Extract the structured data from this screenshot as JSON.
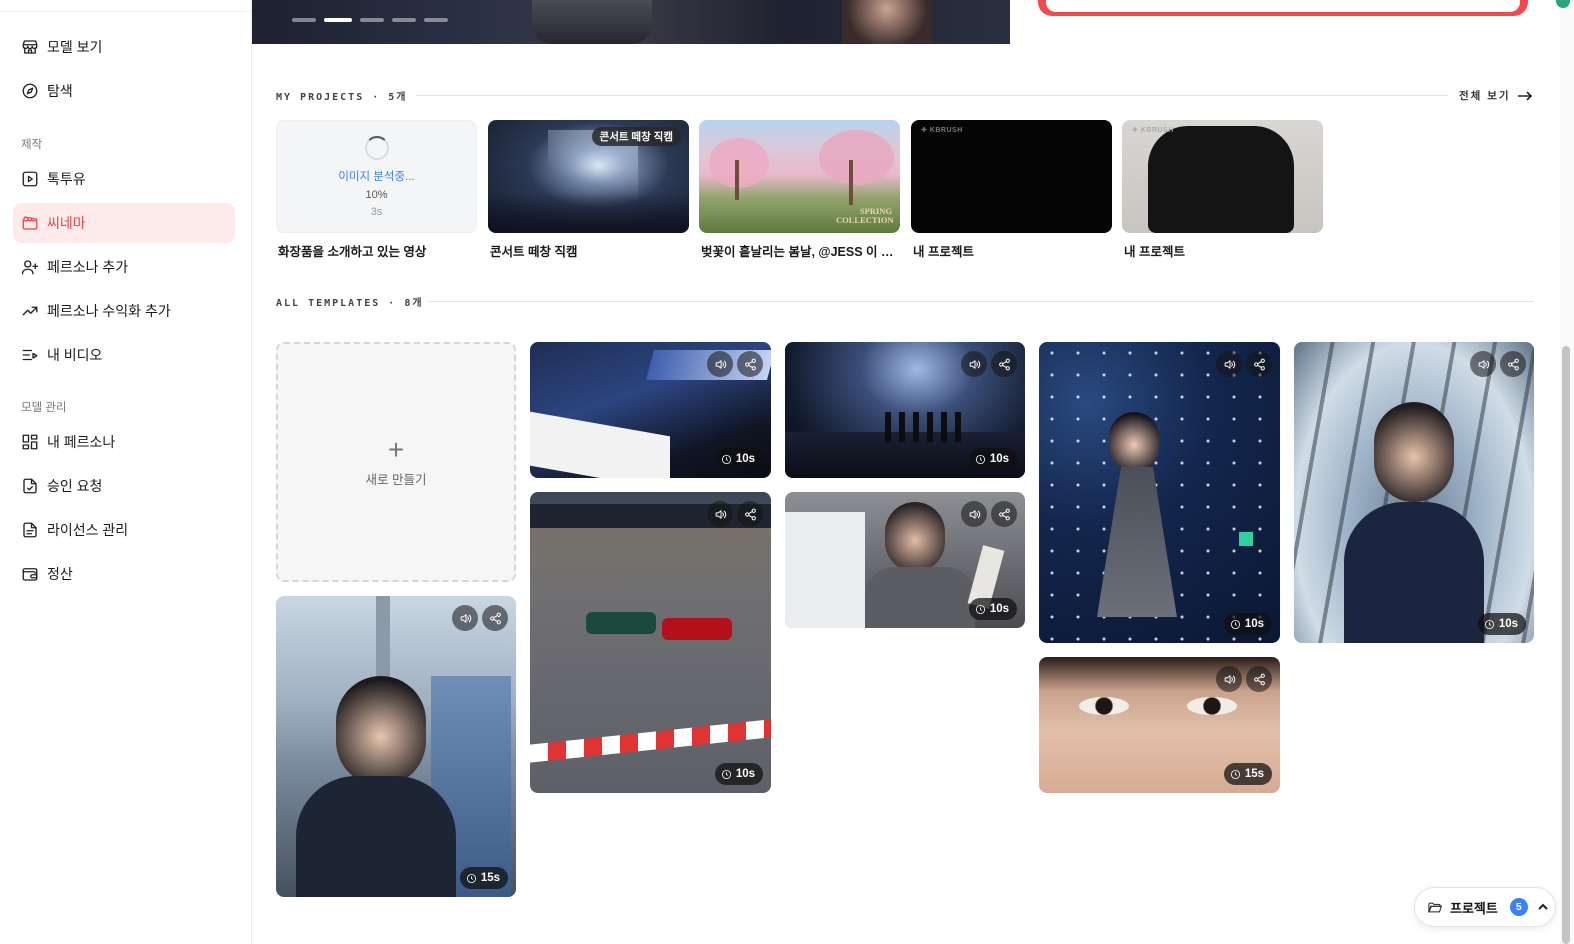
{
  "sidebar": {
    "items": [
      {
        "label": "모델 보기",
        "icon": "store-icon"
      },
      {
        "label": "탐색",
        "icon": "compass-icon"
      }
    ],
    "section_create": "제작",
    "create_items": [
      {
        "label": "톡투유",
        "icon": "play-square-icon"
      },
      {
        "label": "씨네마",
        "icon": "clapperboard-icon",
        "active": true
      },
      {
        "label": "페르소나 추가",
        "icon": "user-plus-icon"
      },
      {
        "label": "페르소나 수익화 추가",
        "icon": "trending-up-icon"
      },
      {
        "label": "내 비디오",
        "icon": "list-video-icon"
      }
    ],
    "section_manage": "모델 관리",
    "manage_items": [
      {
        "label": "내 페르소나",
        "icon": "grid-icon"
      },
      {
        "label": "승인 요청",
        "icon": "file-check-icon"
      },
      {
        "label": "라이선스 관리",
        "icon": "file-text-icon"
      },
      {
        "label": "정산",
        "icon": "wallet-icon"
      }
    ]
  },
  "projects": {
    "heading": "MY PROJECTS · 5개",
    "view_all": "전체 보기",
    "items": [
      {
        "title": "화장품을 소개하고 있는 영상",
        "status": "이미지 분석중...",
        "progress": "10%",
        "elapsed": "3s"
      },
      {
        "title": "콘서트 떼창 직캠",
        "badge": "콘서트 떼창 직캠"
      },
      {
        "title": "벚꽃이 흩날리는 봄날, @JESS 이 환...",
        "overlay": "SPRING COLLECTION"
      },
      {
        "title": "내 프로젝트"
      },
      {
        "title": "내 프로젝트"
      }
    ]
  },
  "templates": {
    "heading": "ALL TEMPLATES · 8개",
    "new_label": "새로 만들기",
    "items": [
      {
        "duration": "15s",
        "scene": "tower-slide"
      },
      {
        "duration": "10s",
        "scene": "esports-championship"
      },
      {
        "duration": "10s",
        "scene": "f1-race"
      },
      {
        "duration": "10s",
        "scene": "concert-stage"
      },
      {
        "duration": "10s",
        "scene": "baseball-crowd"
      },
      {
        "duration": "10s",
        "scene": "singer-stage"
      },
      {
        "duration": "15s",
        "scene": "eyes-closeup"
      },
      {
        "duration": "10s",
        "scene": "fisheye-tower"
      }
    ]
  },
  "footer_pill": {
    "label": "프로젝트",
    "count": "5"
  },
  "colors": {
    "accent": "#e5484d",
    "active_bg": "#fdeaea",
    "badge_blue": "#3b82f6"
  }
}
